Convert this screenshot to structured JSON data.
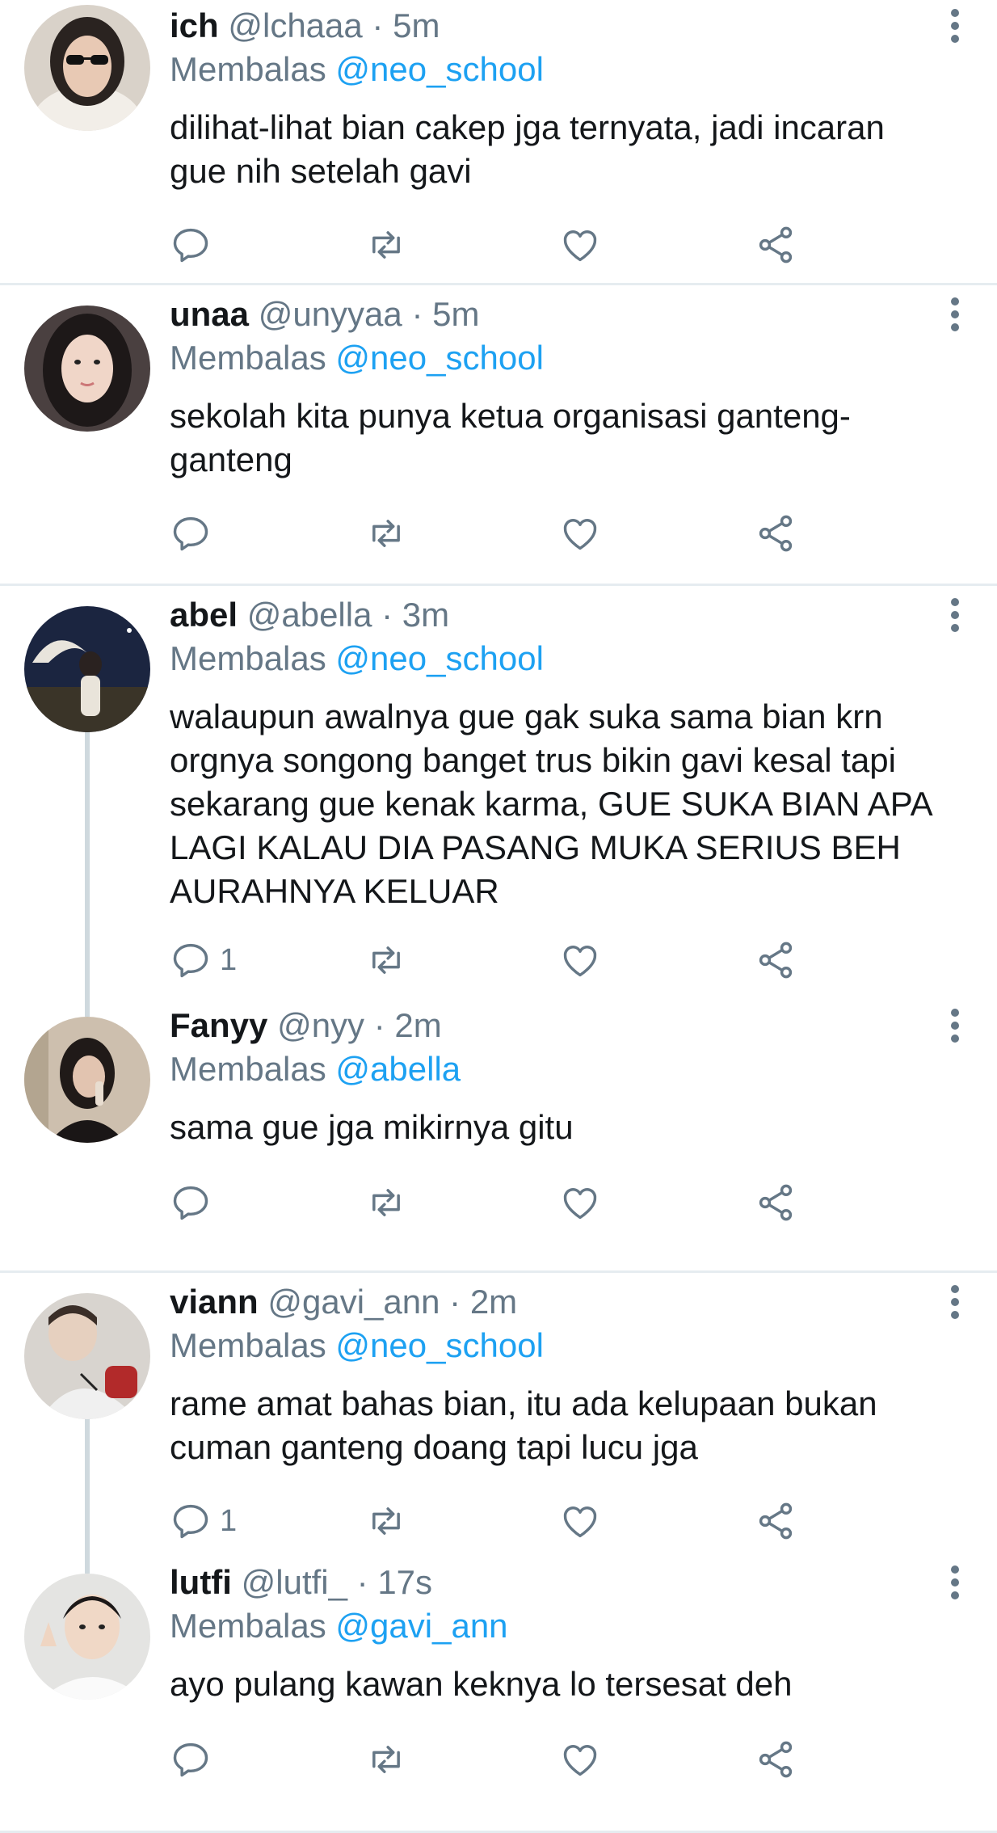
{
  "reply_prefix": "Membalas",
  "colors": {
    "mention": "#1da1f2",
    "meta": "#657786",
    "divider": "#e6ecf0",
    "thread_line": "#cfd9de"
  },
  "icons": {
    "reply": "reply-icon",
    "retweet": "retweet-icon",
    "like": "heart-icon",
    "share": "share-icon",
    "more": "more-vertical-icon"
  },
  "tweets": [
    {
      "name": "ich",
      "meta": "@lchaaa · 5m",
      "replying_to": "@neo_school",
      "text": "dilihat-lihat bian cakep jga ternyata, jadi incaran gue nih setelah gavi",
      "reply_count": ""
    },
    {
      "name": "unaa",
      "meta": "@unyyaa · 5m",
      "replying_to": "@neo_school",
      "text": "sekolah kita punya ketua organisasi ganteng-ganteng",
      "reply_count": ""
    },
    {
      "name": "abel",
      "meta": "@abella · 3m",
      "replying_to": "@neo_school",
      "text": "walaupun awalnya gue gak suka sama bian krn orgnya songong banget trus bikin gavi kesal tapi sekarang gue kenak karma, GUE SUKA BIAN APA LAGI KALAU DIA PASANG MUKA SERIUS BEH AURAHNYA KELUAR",
      "reply_count": "1"
    },
    {
      "name": "Fanyy",
      "meta": "@nyy · 2m",
      "replying_to": "@abella",
      "text": "sama gue jga mikirnya gitu",
      "reply_count": ""
    },
    {
      "name": "viann",
      "meta": "@gavi_ann · 2m",
      "replying_to": "@neo_school",
      "text": "rame amat bahas bian, itu ada kelupaan bukan cuman ganteng doang tapi lucu jga",
      "reply_count": "1"
    },
    {
      "name": "lutfi",
      "meta": "@lutfi_ · 17s",
      "replying_to": "@gavi_ann",
      "text": "ayo pulang kawan keknya lo tersesat deh",
      "reply_count": ""
    }
  ]
}
